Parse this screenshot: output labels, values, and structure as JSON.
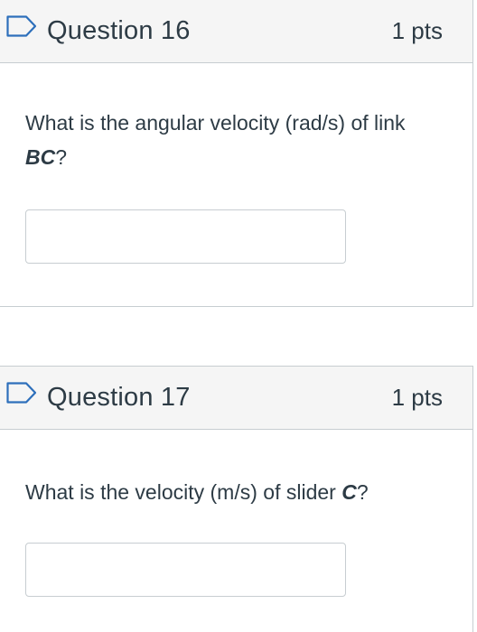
{
  "questions": [
    {
      "title": "Question 16",
      "points": "1 pts",
      "text_before": "What is the angular velocity (rad/s) of link ",
      "text_bold": "BC",
      "text_after": "?",
      "answer_value": "",
      "flag_icon": "bookmark-flag-icon"
    },
    {
      "title": "Question 17",
      "points": "1 pts",
      "text_before": "What is the velocity (m/s) of slider ",
      "text_bold": "C",
      "text_after": "?",
      "answer_value": "",
      "flag_icon": "bookmark-flag-icon"
    }
  ],
  "colors": {
    "text": "#2d3b45",
    "header_bg": "#f5f5f5",
    "border": "#c7cdd1",
    "flag": "#2d6fbb"
  }
}
